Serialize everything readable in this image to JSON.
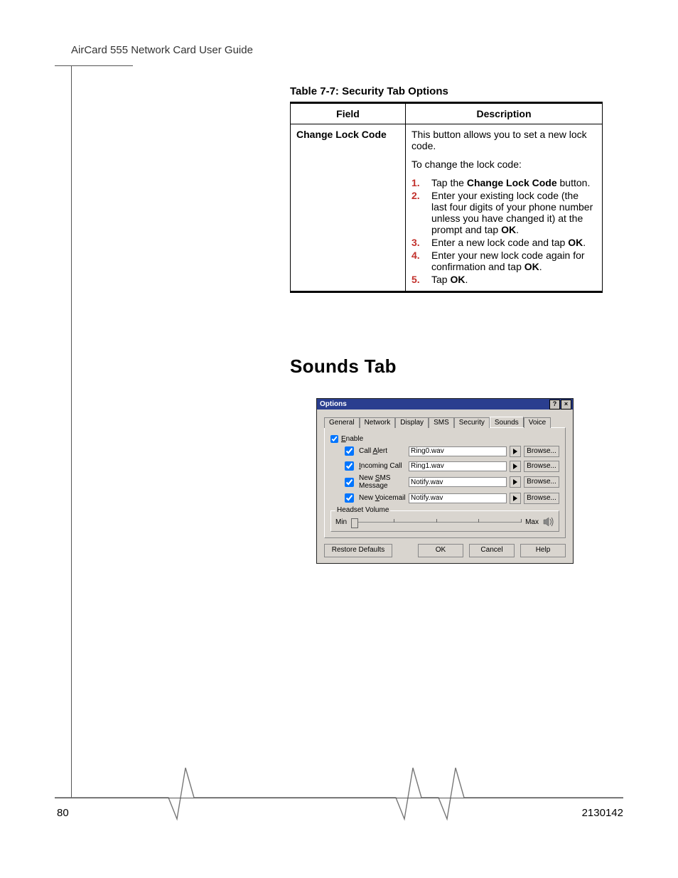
{
  "header": {
    "running_head": "AirCard 555 Network Card User Guide"
  },
  "table": {
    "caption": "Table 7-7: Security Tab Options",
    "head": {
      "field": "Field",
      "description": "Description"
    },
    "row": {
      "field": "Change Lock Code",
      "intro": "This button allows you to set a new lock code.",
      "lead": "To change the lock code:",
      "steps": [
        {
          "num": "1.",
          "pre": "Tap the ",
          "bold": "Change Lock Code",
          "post": " button."
        },
        {
          "num": "2.",
          "pre": "Enter your existing lock code (the last four digits of your phone number unless you have changed it) at the prompt and tap ",
          "bold": "OK",
          "post": "."
        },
        {
          "num": "3.",
          "pre": "Enter a new lock code and tap ",
          "bold": "OK",
          "post": "."
        },
        {
          "num": "4.",
          "pre": "Enter your new lock code again for confirmation and tap ",
          "bold": "OK",
          "post": "."
        },
        {
          "num": "5.",
          "pre": "Tap ",
          "bold": "OK",
          "post": "."
        }
      ]
    }
  },
  "section": {
    "heading": "Sounds Tab"
  },
  "dialog": {
    "title": "Options",
    "help_btn": "?",
    "close_btn": "×",
    "tabs": [
      "General",
      "Network",
      "Display",
      "SMS",
      "Security",
      "Sounds",
      "Voice"
    ],
    "active_tab": "Sounds",
    "enable_label": "Enable",
    "enable_underline": "E",
    "enable_checked": true,
    "rows": [
      {
        "checked": true,
        "label_pre": "Call ",
        "label_ul": "A",
        "label_post": "lert",
        "value": "Ring0.wav",
        "browse": "Browse..."
      },
      {
        "checked": true,
        "label_pre": "",
        "label_ul": "I",
        "label_post": "ncoming Call",
        "value": "Ring1.wav",
        "browse": "Browse..."
      },
      {
        "checked": true,
        "label_pre": "New ",
        "label_ul": "S",
        "label_post": "MS Message",
        "value": "Notify.wav",
        "browse": "Browse..."
      },
      {
        "checked": true,
        "label_pre": "New ",
        "label_ul": "V",
        "label_post": "oicemail",
        "value": "Notify.wav",
        "browse": "Browse..."
      }
    ],
    "volume": {
      "legend": "Headset Volume",
      "min": "Min",
      "max": "Max"
    },
    "buttons": {
      "restore": "Restore Defaults",
      "ok": "OK",
      "cancel": "Cancel",
      "help": "Help"
    }
  },
  "footer": {
    "page": "80",
    "docnum": "2130142"
  }
}
